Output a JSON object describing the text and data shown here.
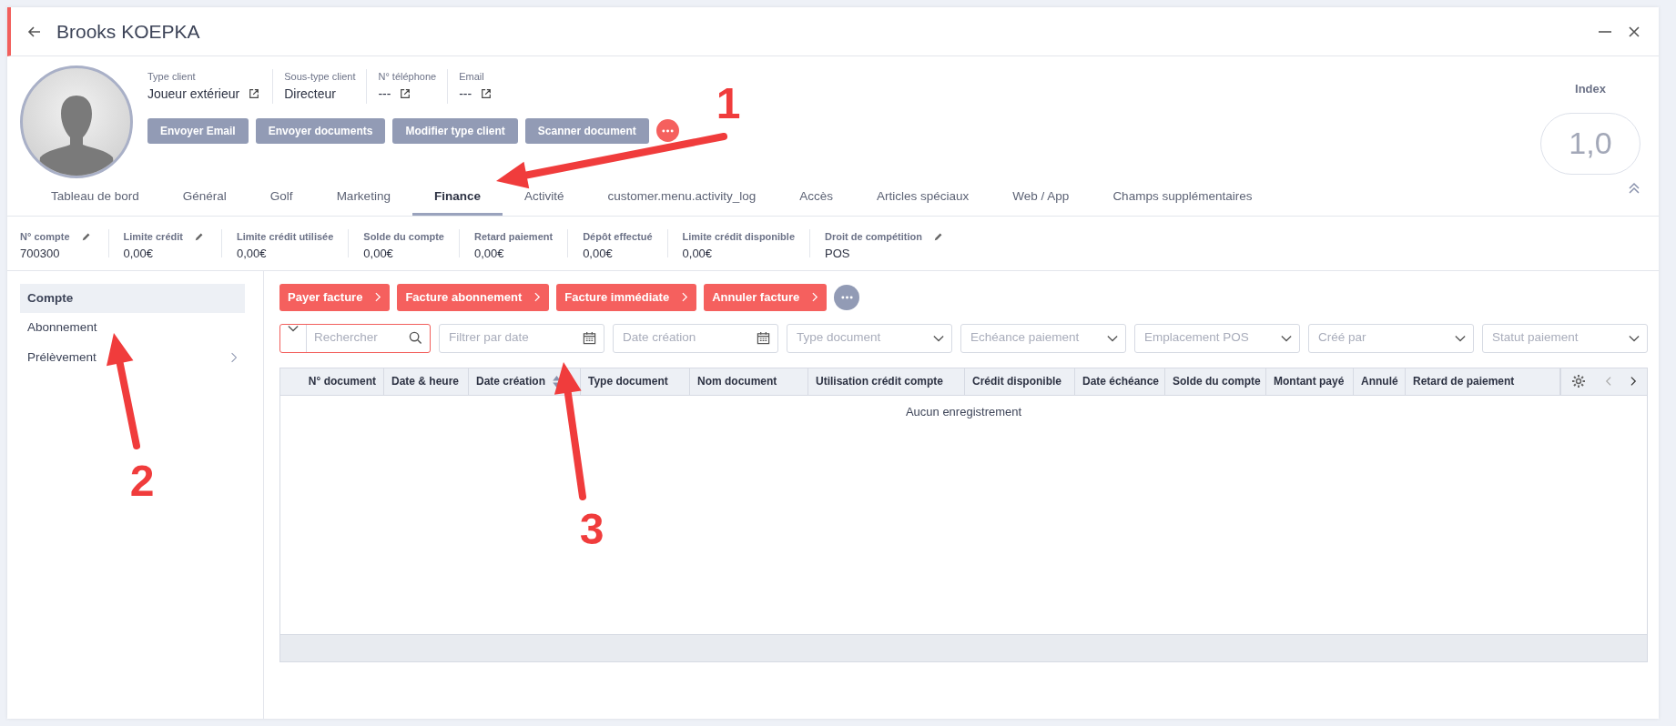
{
  "header": {
    "title": "Brooks KOEPKA"
  },
  "profile": {
    "fields": [
      {
        "label": "Type client",
        "value": "Joueur extérieur",
        "link": true
      },
      {
        "label": "Sous-type client",
        "value": "Directeur",
        "link": false
      },
      {
        "label": "N° téléphone",
        "value": "---",
        "link": true
      },
      {
        "label": "Email",
        "value": "---",
        "link": true
      }
    ],
    "buttons": [
      "Envoyer Email",
      "Envoyer documents",
      "Modifier type client",
      "Scanner document"
    ]
  },
  "index": {
    "label": "Index",
    "value": "1,0"
  },
  "tabs": [
    {
      "label": "Tableau de bord",
      "selected": false
    },
    {
      "label": "Général",
      "selected": false
    },
    {
      "label": "Golf",
      "selected": false
    },
    {
      "label": "Marketing",
      "selected": false
    },
    {
      "label": "Finance",
      "selected": true
    },
    {
      "label": "Activité",
      "selected": false
    },
    {
      "label": "customer.menu.activity_log",
      "selected": false
    },
    {
      "label": "Accès",
      "selected": false
    },
    {
      "label": "Articles spéciaux",
      "selected": false
    },
    {
      "label": "Web / App",
      "selected": false
    },
    {
      "label": "Champs supplémentaires",
      "selected": false
    }
  ],
  "account_fields": [
    {
      "label": "N° compte",
      "value": "700300",
      "editable": true
    },
    {
      "label": "Limite crédit",
      "value": "0,00€",
      "editable": true
    },
    {
      "label": "Limite crédit utilisée",
      "value": "0,00€",
      "editable": false
    },
    {
      "label": "Solde du compte",
      "value": "0,00€",
      "editable": false
    },
    {
      "label": "Retard paiement",
      "value": "0,00€",
      "editable": false
    },
    {
      "label": "Dépôt effectué",
      "value": "0,00€",
      "editable": false
    },
    {
      "label": "Limite crédit disponible",
      "value": "0,00€",
      "editable": false
    },
    {
      "label": "Droit de compétition",
      "value": "POS",
      "editable": true
    }
  ],
  "sidebar": {
    "items": [
      {
        "label": "Compte",
        "selected": true,
        "has_children": false
      },
      {
        "label": "Abonnement",
        "selected": false,
        "has_children": false
      },
      {
        "label": "Prélèvement",
        "selected": false,
        "has_children": true
      }
    ]
  },
  "actions": [
    "Payer facture",
    "Facture abonnement",
    "Facture immédiate",
    "Annuler facture"
  ],
  "filters": [
    {
      "kind": "search",
      "placeholder": "Rechercher"
    },
    {
      "kind": "date",
      "placeholder": "Filtrer par date"
    },
    {
      "kind": "date",
      "placeholder": "Date création"
    },
    {
      "kind": "select",
      "placeholder": "Type document"
    },
    {
      "kind": "select",
      "placeholder": "Echéance paiement"
    },
    {
      "kind": "select",
      "placeholder": "Emplacement POS"
    },
    {
      "kind": "select",
      "placeholder": "Créé par"
    },
    {
      "kind": "select",
      "placeholder": "Statut paiement"
    }
  ],
  "table": {
    "columns": [
      {
        "label": "N° document",
        "sortable": false
      },
      {
        "label": "Date & heure",
        "sortable": false
      },
      {
        "label": "Date création",
        "sortable": true
      },
      {
        "label": "Type document",
        "sortable": false
      },
      {
        "label": "Nom document",
        "sortable": false
      },
      {
        "label": "Utilisation crédit compte",
        "sortable": false
      },
      {
        "label": "Crédit disponible",
        "sortable": false
      },
      {
        "label": "Date échéance",
        "sortable": false
      },
      {
        "label": "Solde du compte",
        "sortable": false
      },
      {
        "label": "Montant payé",
        "sortable": false
      },
      {
        "label": "Annulé",
        "sortable": false
      },
      {
        "label": "Retard de paiement",
        "sortable": false
      }
    ],
    "empty_message": "Aucun enregistrement"
  },
  "annotations": [
    {
      "label": "1"
    },
    {
      "label": "2"
    },
    {
      "label": "3"
    }
  ]
}
